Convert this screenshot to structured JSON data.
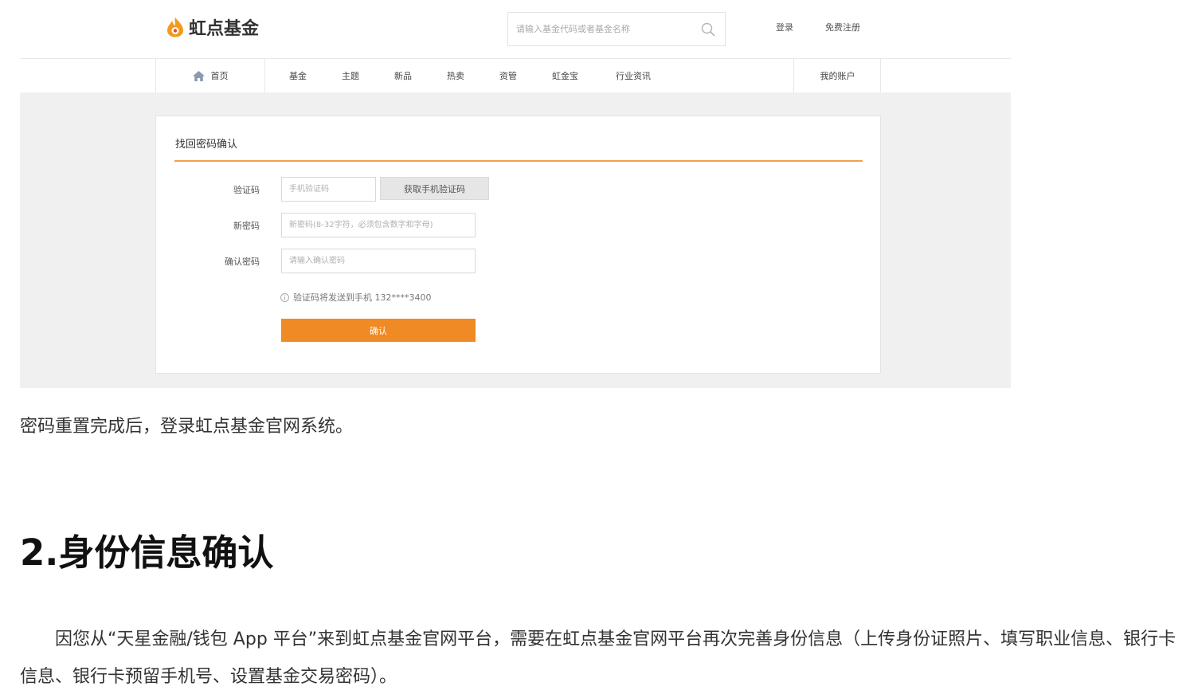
{
  "brand": {
    "name": "虹点基金",
    "accent": "#ef8a24"
  },
  "header": {
    "search_placeholder": "请输入基金代码或者基金名称",
    "login": "登录",
    "register": "免费注册"
  },
  "nav": {
    "home": "首页",
    "items": [
      "基金",
      "主题",
      "新品",
      "热卖",
      "资管",
      "虹金宝",
      "行业资讯"
    ],
    "account": "我的账户"
  },
  "form": {
    "title": "找回密码确认",
    "code_label": "验证码",
    "code_placeholder": "手机验证码",
    "get_code_button": "获取手机验证码",
    "new_password_label": "新密码",
    "new_password_placeholder": "新密码(8-32字符，必须包含数字和字母)",
    "confirm_password_label": "确认密码",
    "confirm_password_placeholder": "请输入确认密码",
    "hint": "验证码将发送到手机 132****3400",
    "confirm_button": "确认"
  },
  "article": {
    "paragraph1": "密码重置完成后，登录虹点基金官网系统。",
    "heading": "2.身份信息确认",
    "paragraph2": "因您从“天星金融/钱包 App 平台”来到虹点基金官网平台，需要在虹点基金官网平台再次完善身份信息（上传身份证照片、填写职业信息、银行卡信息、银行卡预留手机号、设置基金交易密码）。"
  }
}
